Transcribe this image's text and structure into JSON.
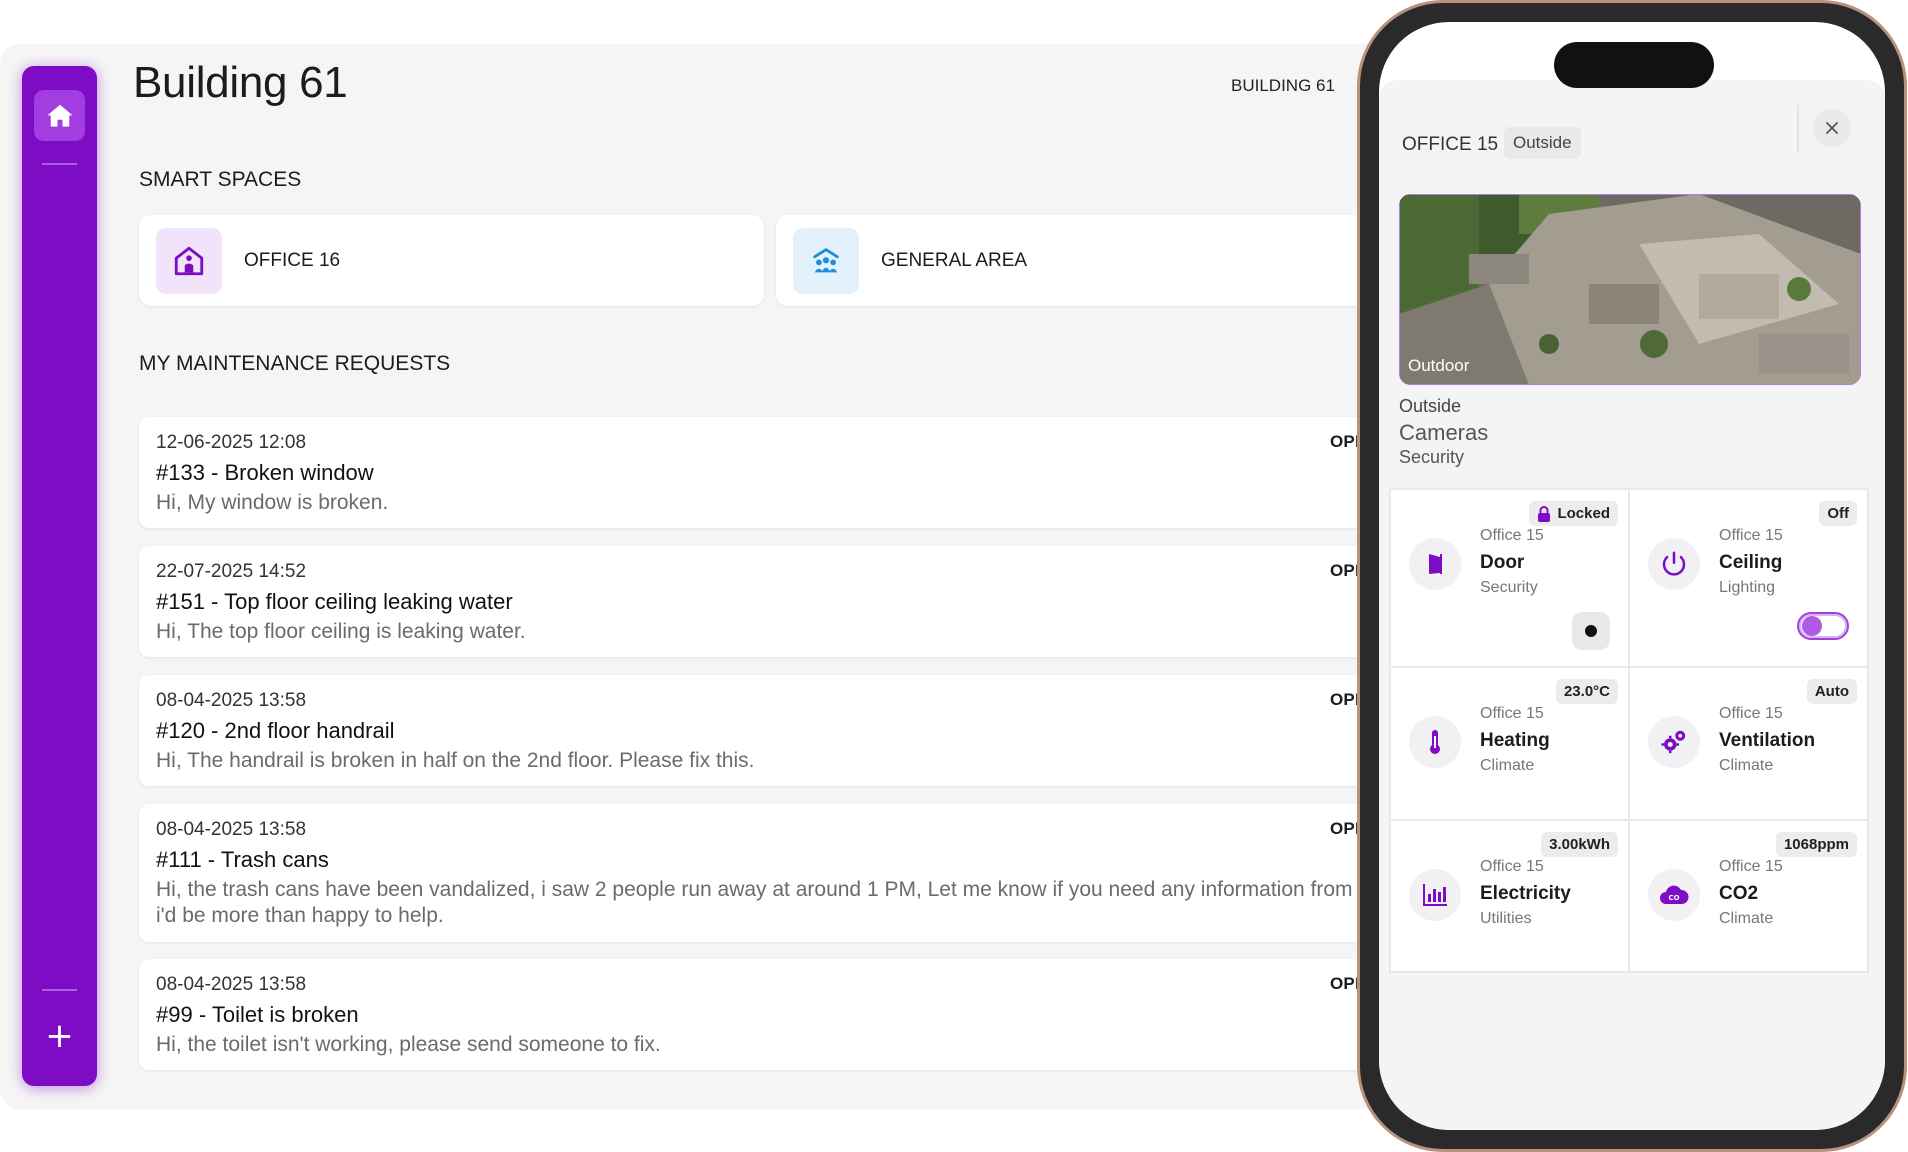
{
  "page": {
    "title": "Building 61",
    "breadcrumb": "BUILDING 61"
  },
  "rail": {
    "add_label": "+"
  },
  "smart_spaces": {
    "heading": "SMART SPACES",
    "items": [
      {
        "label": "OFFICE 16",
        "icon": "office-person-icon",
        "color": "#7e0cc4",
        "bg": "#f1e4fa"
      },
      {
        "label": "GENERAL AREA",
        "icon": "people-group-icon",
        "color": "#1e8fd6",
        "bg": "#e2f1fb"
      }
    ]
  },
  "maintenance": {
    "heading": "MY MAINTENANCE REQUESTS",
    "requests": [
      {
        "date": "12-06-2025 12:08",
        "status": "OPENED",
        "title": "#133 - Broken window",
        "desc": "Hi, My window is broken."
      },
      {
        "date": "22-07-2025 14:52",
        "status": "OPENED",
        "title": "#151 - Top floor ceiling leaking water",
        "desc": "Hi, The top floor ceiling is leaking water."
      },
      {
        "date": "08-04-2025 13:58",
        "status": "OPENED",
        "title": "#120 - 2nd floor handrail",
        "desc": "Hi, The handrail is broken in half on the 2nd floor. Please fix this."
      },
      {
        "date": "08-04-2025 13:58",
        "status": "OPENED",
        "title": "#111 - Trash cans",
        "desc": "Hi, the trash cans have been vandalized, i saw 2 people run away at around 1 PM, Let me know if you need any information from me, i'd be more than happy to help."
      },
      {
        "date": "08-04-2025 13:58",
        "status": "OPENED",
        "title": "#99 - Toilet is broken",
        "desc": "Hi, the toilet isn't working, please send someone to fix."
      }
    ]
  },
  "phone": {
    "header": {
      "office": "OFFICE 15 •",
      "chip": "Outside"
    },
    "camera": {
      "overlay": "Outdoor",
      "location": "Outside",
      "name": "Cameras",
      "category": "Security"
    },
    "tiles": [
      {
        "badge": "Locked",
        "location": "Office 15",
        "name": "Door",
        "category": "Security",
        "icon": "door-icon"
      },
      {
        "badge": "Off",
        "location": "Office 15",
        "name": "Ceiling",
        "category": "Lighting",
        "icon": "power-icon",
        "toggle_on": false
      },
      {
        "badge": "23.0°C",
        "location": "Office 15",
        "name": "Heating",
        "category": "Climate",
        "icon": "thermometer-icon"
      },
      {
        "badge": "Auto",
        "location": "Office 15",
        "name": "Ventilation",
        "category": "Climate",
        "icon": "gears-icon"
      },
      {
        "badge": "3.00kWh",
        "location": "Office 15",
        "name": "Electricity",
        "category": "Utilities",
        "icon": "bar-chart-icon"
      },
      {
        "badge": "1068ppm",
        "location": "Office 15",
        "name": "CO2",
        "category": "Climate",
        "icon": "co2-cloud-icon"
      }
    ]
  },
  "colors": {
    "accent": "#7e0cc4",
    "accent_light": "#a23ee0"
  }
}
